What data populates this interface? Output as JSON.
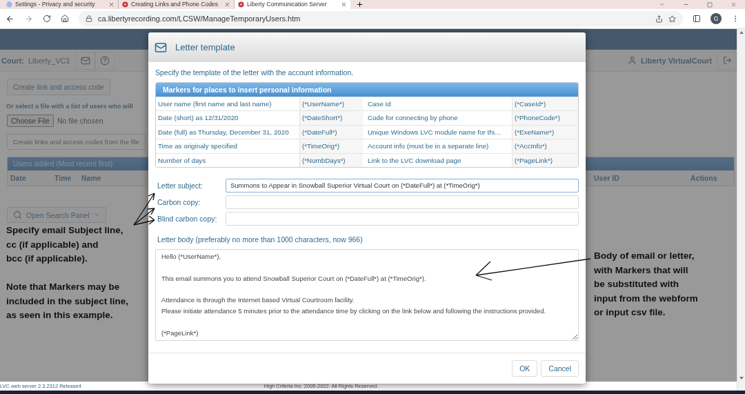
{
  "browser": {
    "tabs": [
      {
        "label": "Settings - Privacy and security",
        "selected": false
      },
      {
        "label": "Creating Links and Phone Codes",
        "selected": false
      },
      {
        "label": "Liberty Communication Server",
        "selected": true
      }
    ],
    "url": "ca.libertyrecording.com/LCSW/ManageTemporaryUsers.htm",
    "avatar": "G"
  },
  "app": {
    "court_label": "Court:",
    "court_value": "Liberty_VC1",
    "user": "Liberty VirtualCourt",
    "create_button": "Create link and access code",
    "file_prompt": "Or select a file with a list of users who will",
    "choose_file": "Choose File",
    "no_file": "No file chosen",
    "create_from_file": {
      "label": "Create links and access codes from the file",
      "disabled": true
    },
    "users_panel": {
      "title": "Users added (Most recent first)",
      "columns": [
        "Date",
        "Time",
        "Name",
        "User ID",
        "Actions"
      ]
    },
    "search_button": "Open Search Panel",
    "version": "LVC web server 2.3.2312 Release4",
    "copyright": "High Criteria Inc. 2005-2022. All Rights Reserved."
  },
  "dialog": {
    "title": "Letter template",
    "intro": "Specify the template of the letter with the account information.",
    "markers": {
      "title": "Markers for places to insert personal information",
      "rows": [
        {
          "left_label": "User name (first name and last name)",
          "left_marker": "(*UserName*)",
          "right_label": "Case Id",
          "right_marker": "(*CaseId*)"
        },
        {
          "left_label": "Date (short) as 12/31/2020",
          "left_marker": "(*DateShort*)",
          "right_label": "Code for connecting by phone",
          "right_marker": "(*PhoneCode*)"
        },
        {
          "left_label": "Date (full) as Thursday, December 31, 2020",
          "left_marker": "(*DateFull*)",
          "right_label": "Unique Windows LVC module name for thi…",
          "right_marker": "(*ExeName*)"
        },
        {
          "left_label": "Time as originaly specified",
          "left_marker": "(*TimeOrig*)",
          "right_label": "Account info (must be in a separate line)",
          "right_marker": "(*AccInfo*)"
        },
        {
          "left_label": "Number of days",
          "left_marker": "(*NumbDays*)",
          "right_label": "Link to the LVC download page",
          "right_marker": "(*PageLink*)"
        }
      ]
    },
    "fields": [
      {
        "label": "Letter subject:",
        "value": "Summons to Appear in Snowball Superior Virtual Court on (*DateFull*) at (*TimeOrig*)",
        "focused": true
      },
      {
        "label": "Carbon copy:",
        "focused": false
      },
      {
        "label": "Blind carbon copy:",
        "focused": false
      }
    ],
    "body_label": "Letter body (preferably no more than 1000 characters, now 966)",
    "body": [
      [
        "Hello (*UserName*),"
      ],
      [
        "This email summons you to attend Snowball Superior Court on (*DateFull*) at (*TimeOrig*)."
      ],
      [
        "Attendance is through the Internet based Virtual Courtroom facility.",
        "Please initiate attendance 5 minutes prior to the attendance time by clicking on the link below and following the instructions provided."
      ],
      [
        "(*PageLink*)"
      ]
    ],
    "buttons": [
      "OK",
      "Cancel"
    ]
  },
  "annotations": [
    {
      "lines": [
        "Specify email Subject line,",
        "cc (if applicable) and",
        "bcc (if applicable)."
      ]
    },
    {
      "lines": [
        "Note that Markers may be",
        "included in the subject line,",
        "as seen in this example."
      ]
    },
    {
      "lines": [
        "Body of email or letter,",
        "with Markers that will",
        "be substituted with",
        "input from the webform",
        "or input csv file."
      ]
    }
  ]
}
